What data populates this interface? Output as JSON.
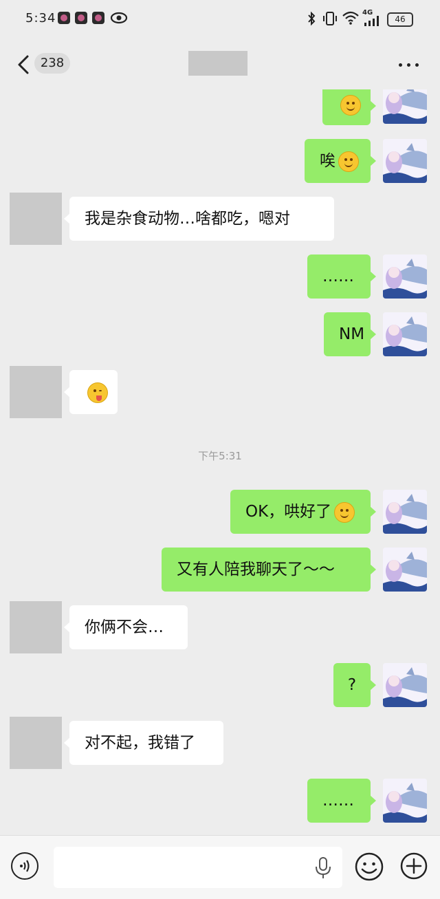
{
  "status_bar": {
    "time": "5:34",
    "network": "4G",
    "battery": "46",
    "icons": [
      "notification-app-icon",
      "notification-app-icon",
      "notification-app-icon",
      "eye-icon",
      "bluetooth-icon",
      "vibrate-icon",
      "wifi-icon",
      "cellular-signal-icon",
      "battery-icon"
    ]
  },
  "nav": {
    "unread_count": "238",
    "title": "",
    "icons": [
      "back-arrow-icon",
      "more-dots-icon"
    ]
  },
  "messages": [
    {
      "side": "own",
      "text": "",
      "emoji": "pleading-face"
    },
    {
      "side": "own",
      "text": "唉",
      "emoji": "relieved-face"
    },
    {
      "side": "other",
      "text": "我是杂食动物…啥都吃，嗯对"
    },
    {
      "side": "own",
      "text": "……"
    },
    {
      "side": "own",
      "text": "NM"
    },
    {
      "side": "other",
      "text": "",
      "emoji": "winking-tongue-face"
    },
    {
      "timestamp": "下午5:31"
    },
    {
      "side": "own",
      "text": "OK，哄好了",
      "emoji": "smile-face"
    },
    {
      "side": "own",
      "text": "又有人陪我聊天了～～"
    },
    {
      "side": "other",
      "text": "你俩不会…"
    },
    {
      "side": "own",
      "text": "?"
    },
    {
      "side": "other",
      "text": "对不起，我错了"
    },
    {
      "side": "own",
      "text": "……"
    }
  ],
  "input_bar": {
    "placeholder": "",
    "icons": [
      "voice-icon",
      "mic-icon",
      "emoji-icon",
      "plus-icon"
    ]
  },
  "colors": {
    "background": "#ededed",
    "own_bubble": "#95ec69",
    "other_bubble": "#ffffff"
  }
}
